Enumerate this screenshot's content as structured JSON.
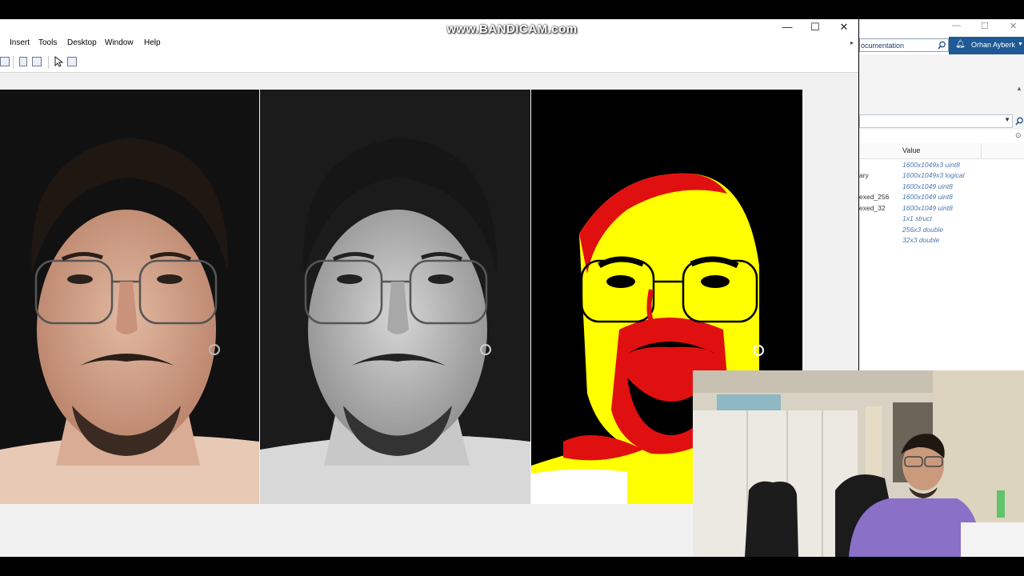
{
  "watermark": "www.BANDICAM.com",
  "figure_window": {
    "menu": [
      "Insert",
      "Tools",
      "Desktop",
      "Window",
      "Help"
    ],
    "controls": {
      "minimize": "—",
      "maximize": "☐",
      "close": "✕"
    },
    "subplots": [
      {
        "label": "original-rgb"
      },
      {
        "label": "grayscale"
      },
      {
        "label": "indexed-colormap"
      }
    ]
  },
  "matlab_desktop": {
    "doc_search_placeholder": "ocumentation",
    "user": "Orhan Ayberk",
    "workspace": {
      "value_header": "Value",
      "variables": [
        {
          "name": "",
          "value": "1600x1049x3 uint8"
        },
        {
          "name": "ary",
          "value": "1600x1049x3 logical"
        },
        {
          "name": "",
          "value": "1600x1049 uint8"
        },
        {
          "name": "exed_256",
          "value": "1600x1049 uint8"
        },
        {
          "name": "exed_32",
          "value": "1600x1049 uint8"
        },
        {
          "name": "",
          "value": "1x1 struct"
        },
        {
          "name": "",
          "value": "256x3 double"
        },
        {
          "name": "",
          "value": "32x3 double"
        }
      ]
    }
  },
  "colors": {
    "matlab_blue": "#1f5a96",
    "workspace_value": "#4a78b0",
    "figure_bg": "#f0f0f0",
    "thresh_yellow": "#ffff00",
    "thresh_red": "#e01010"
  }
}
